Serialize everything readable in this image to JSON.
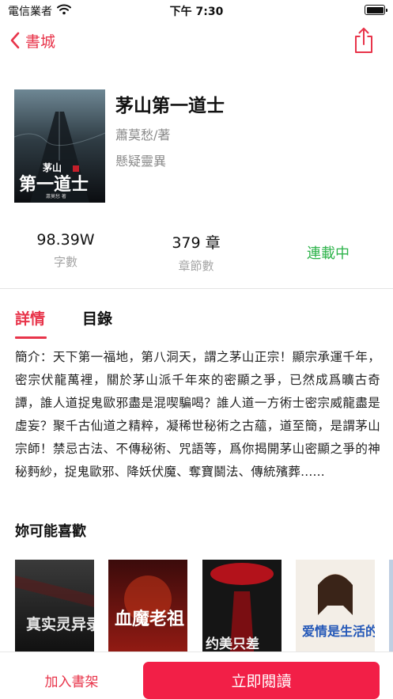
{
  "status_bar": {
    "carrier": "電信業者",
    "time": "下午 7:30"
  },
  "nav": {
    "back_label": "書城"
  },
  "book": {
    "title": "茅山第一道士",
    "author": "蕭莫愁",
    "author_suffix": "/著",
    "category": "懸疑靈異",
    "cover_text": {
      "small": "茅山",
      "big": "第一道士",
      "sub": "蕭莫愁 著"
    }
  },
  "stats": {
    "words": {
      "value": "98.39W",
      "label": "字數"
    },
    "chapters": {
      "value": "379 章",
      "label": "章節數"
    },
    "status": "連載中"
  },
  "tabs": {
    "details": "詳情",
    "catalog": "目錄"
  },
  "synopsis": "簡介：天下第一福地，第八洞天，謂之茅山正宗！顯宗承運千年，密宗伏龍萬裡，關於茅山派千年來的密顯之爭，已然成爲曠古奇譚，誰人道捉鬼歐邪盡是混喫騙喝？誰人道一方術士密宗威龍盡是虛妄？聚千古仙道之精粹，凝稀世秘術之古蘊，道至簡，是謂茅山宗師！禁忌古法、不傳秘術、咒語等，爲你揭開茅山密顯之爭的神秘麪紗，捉鬼歐邪、降妖伏魔、奪寶鬭法、傳統殯葬......",
  "recommend": {
    "title": "妳可能喜歡",
    "books": [
      {
        "cover_text": "真实灵异录"
      },
      {
        "cover_text": "血魔老祖"
      },
      {
        "cover_text": "约美只差"
      },
      {
        "cover_text": "爱情是生活的皮"
      }
    ]
  },
  "bottom": {
    "add_shelf": "加入書架",
    "read_now": "立即閱讀"
  },
  "colors": {
    "accent": "#e8344a",
    "button": "#f21f47",
    "status_green": "#2db34a"
  }
}
